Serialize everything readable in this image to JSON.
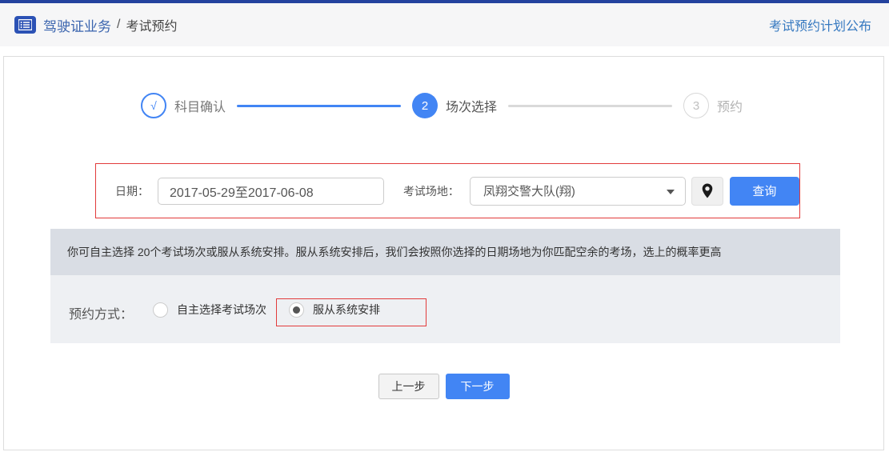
{
  "header": {
    "breadcrumb": {
      "section": "驾驶证业务",
      "separator": "/",
      "page": "考试预约"
    },
    "plan_link": "考试预约计划公布"
  },
  "stepper": {
    "steps": [
      {
        "marker": "√",
        "label": "科目确认",
        "state": "done"
      },
      {
        "marker": "2",
        "label": "场次选择",
        "state": "active"
      },
      {
        "marker": "3",
        "label": "预约",
        "state": "pending"
      }
    ]
  },
  "filter": {
    "date_label": "日期：",
    "date_value": "2017-05-29至2017-06-08",
    "venue_label": "考试场地：",
    "venue_value": "凤翔交警大队(翔)",
    "query_label": "查询"
  },
  "notice_text": "你可自主选择 20个考试场次或服从系统安排。服从系统安排后，我们会按照你选择的日期场地为你匹配空余的考场，选上的概率更高",
  "booking": {
    "label": "预约方式：",
    "options": [
      {
        "label": "自主选择考试场次",
        "selected": false
      },
      {
        "label": "服从系统安排",
        "selected": true
      }
    ]
  },
  "actions": {
    "prev_label": "上一步",
    "next_label": "下一步"
  },
  "colors": {
    "accent_blue": "#4285f4",
    "top_border": "#24429e",
    "breadcrumb_blue": "#3a64ae",
    "link_blue": "#3679c0",
    "highlight_red": "#e23b3b",
    "notice_bg": "#d9dde4",
    "section_bg": "#eef0f3"
  }
}
